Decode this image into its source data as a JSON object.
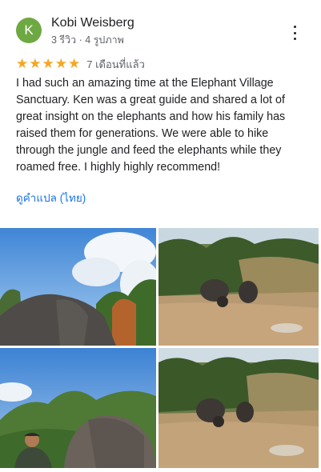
{
  "review": {
    "author": {
      "initial": "K",
      "name": "Kobi Weisberg",
      "meta": "3 รีวิว · 4 รูปภาพ",
      "avatar_color": "#6ea842"
    },
    "rating": {
      "stars": 5,
      "max": 5,
      "glyph": "★",
      "color": "#f5a623"
    },
    "date": "7 เดือนที่แล้ว",
    "text": "I had such an amazing time at the Elephant Village Sanctuary. Ken was a great guide and shared a lot of great insight on the elephants and how his family has raised them for generations. We were able to hike through the jungle and feed the elephants while they roamed free. I highly highly recommend!",
    "translate_label": "ดูคำแปล (ไทย)",
    "menu_icon": "more-vert-icon"
  },
  "colors": {
    "link": "#1a73e8",
    "secondary_text": "#5f6368",
    "primary_text": "#202124"
  }
}
